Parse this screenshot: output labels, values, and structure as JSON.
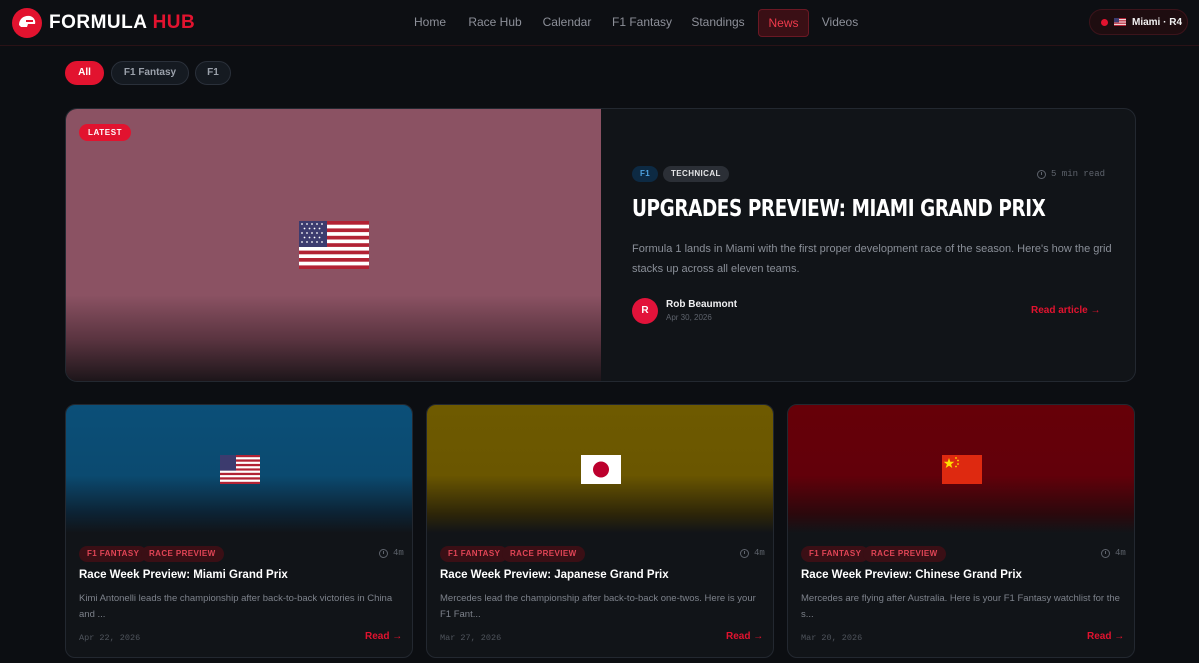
{
  "brand": {
    "name": "FORMULA",
    "accent": "HUB",
    "logo_icon": "helmet-icon",
    "color": "#e2132f"
  },
  "nav": {
    "items": [
      {
        "label": "Home",
        "active": false
      },
      {
        "label": "Race Hub",
        "active": false
      },
      {
        "label": "Calendar",
        "active": false
      },
      {
        "label": "F1 Fantasy",
        "active": false
      },
      {
        "label": "Standings",
        "active": false
      },
      {
        "label": "News",
        "active": true
      },
      {
        "label": "Videos",
        "active": false
      }
    ],
    "race_chip": {
      "label": "Miami · R4",
      "flag": "usa-flag-icon"
    }
  },
  "filters": [
    {
      "label": "All",
      "active": true
    },
    {
      "label": "F1 Fantasy",
      "active": false
    },
    {
      "label": "F1",
      "active": false
    }
  ],
  "featured": {
    "badge": "LATEST",
    "flag": "usa-flag-icon",
    "tags": [
      "F1",
      "TECHNICAL"
    ],
    "read_time": "5 min read",
    "title": "UPGRADES PREVIEW: MIAMI GRAND PRIX",
    "description": "Formula 1 lands in Miami with the first proper development race of the season. Here's how the grid stacks up across all eleven teams.",
    "author": {
      "initial": "R",
      "name": "Rob Beaumont",
      "date": "Apr 30, 2026"
    },
    "cta": "Read article →"
  },
  "articles": [
    {
      "flag": "usa-flag-icon",
      "tags": [
        "F1 FANTASY",
        "RACE PREVIEW"
      ],
      "read_time": "4m",
      "title": "Race Week Preview: Miami Grand Prix",
      "excerpt": "Kimi Antonelli leads the championship after back-to-back victories in China and ...",
      "date": "Apr 22, 2026",
      "cta": "Read →",
      "color": "#0b4f78"
    },
    {
      "flag": "japan-flag-icon",
      "tags": [
        "F1 FANTASY",
        "RACE PREVIEW"
      ],
      "read_time": "4m",
      "title": "Race Week Preview: Japanese Grand Prix",
      "excerpt": "Mercedes lead the championship after back-to-back one-twos. Here is your F1 Fant...",
      "date": "Mar 27, 2026",
      "cta": "Read →",
      "color": "#6e5a00"
    },
    {
      "flag": "china-flag-icon",
      "tags": [
        "F1 FANTASY",
        "RACE PREVIEW"
      ],
      "read_time": "4m",
      "title": "Race Week Preview: Chinese Grand Prix",
      "excerpt": "Mercedes are flying after Australia. Here is your F1 Fantasy watchlist for the s...",
      "date": "Mar 20, 2026",
      "cta": "Read →",
      "color": "#660008"
    }
  ]
}
